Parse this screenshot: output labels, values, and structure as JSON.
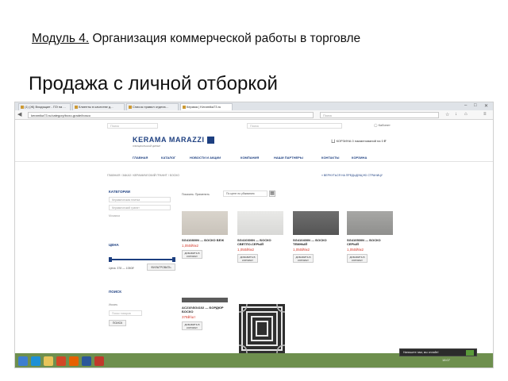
{
  "slide": {
    "module_label": "Модуль 4.",
    "module_text": " Организация коммерческой работы в торговле",
    "title": "Продажа с личной отборкой"
  },
  "browser": {
    "tabs": [
      "(1) (Ж) Входящие - ПЭ на ...",
      "Клиенты в качестве д...",
      "Список правил отдела…",
      "Керама | Keramika73.ru"
    ],
    "url": "keramika73.ru/category/boxo-grade/bosco",
    "search_placeholder": "Поиск"
  },
  "site": {
    "search_placeholder": "Поиск",
    "account": "Кабинет",
    "brand": "KERAMA MARAZZI",
    "brand_sub": "ОФИЦИАЛЬНЫЙ ДИЛЕР",
    "cart_text": "КОРЗИНА  0 наименований на 0 ₽",
    "menu": [
      "ГЛАВНАЯ",
      "КАТАЛОГ",
      "НОВОСТИ И АКЦИИ",
      "КОМПАНИЯ",
      "НАШИ ПАРТНЕРЫ",
      "КОНТАКТЫ",
      "КОРЗИНА"
    ],
    "breadcrumb": "ГЛАВНАЯ / ЗАКАЗ / КЕРАМИЧЕСКИЙ ГРАНИТ / БОСКО",
    "back_link": "« ВЕРНУТЬСЯ НА ПРЕДЫДУЩУЮ СТРАНИЦУ"
  },
  "sidebar": {
    "categories_heading": "КАТЕГОРИИ",
    "category_selects": [
      "Керамическая плитка",
      "Керамический гранит"
    ],
    "category_link": "Мозаика",
    "price_heading": "ЦЕНА",
    "price_range": "Цена: 378 — 1050₽",
    "filter_button": "ФИЛЬТРОВАТЬ",
    "search_heading": "ПОИСК",
    "search_label": "Искать",
    "search_placeholder": "Поиск товаров",
    "find_button": "ПОИСК"
  },
  "toolbar": {
    "sort_label": "Показать: Применить",
    "sort_value": "По цене по убыванию"
  },
  "products": [
    {
      "name": "SG410800N — БОСКО БЕЖ",
      "price": "1,050₽/м2",
      "button": "ДОБАВИТЬ В КОРЗИНУ"
    },
    {
      "name": "SG410300N — БОСКО СВЕТЛО-СЕРЫЙ",
      "price": "1,050₽/м2",
      "button": "ДОБАВИТЬ В КОРЗИНУ"
    },
    {
      "name": "SG410400N — БОСКО ТЕМНЫЙ",
      "price": "1,050₽/м2",
      "button": "ДОБАВИТЬ В КОРЗИНУ"
    },
    {
      "name": "SG410500N — БОСКО СЕРЫЙ",
      "price": "1,050₽/м2",
      "button": "ДОБАВИТЬ В КОРЗИНУ"
    },
    {
      "name": "AC210\\SG4102 — БОРДЮР БОСКО",
      "price": "378₽/шт",
      "button": "ДОБАВИТЬ В КОРЗИНУ"
    }
  ],
  "taskbar": {
    "notification": "Напишите нам, мы онлайн!",
    "clock": "18:07"
  },
  "colors": {
    "brand": "#1d3f80",
    "price": "#d43a2c",
    "taskbar": "#6e8f4e"
  }
}
